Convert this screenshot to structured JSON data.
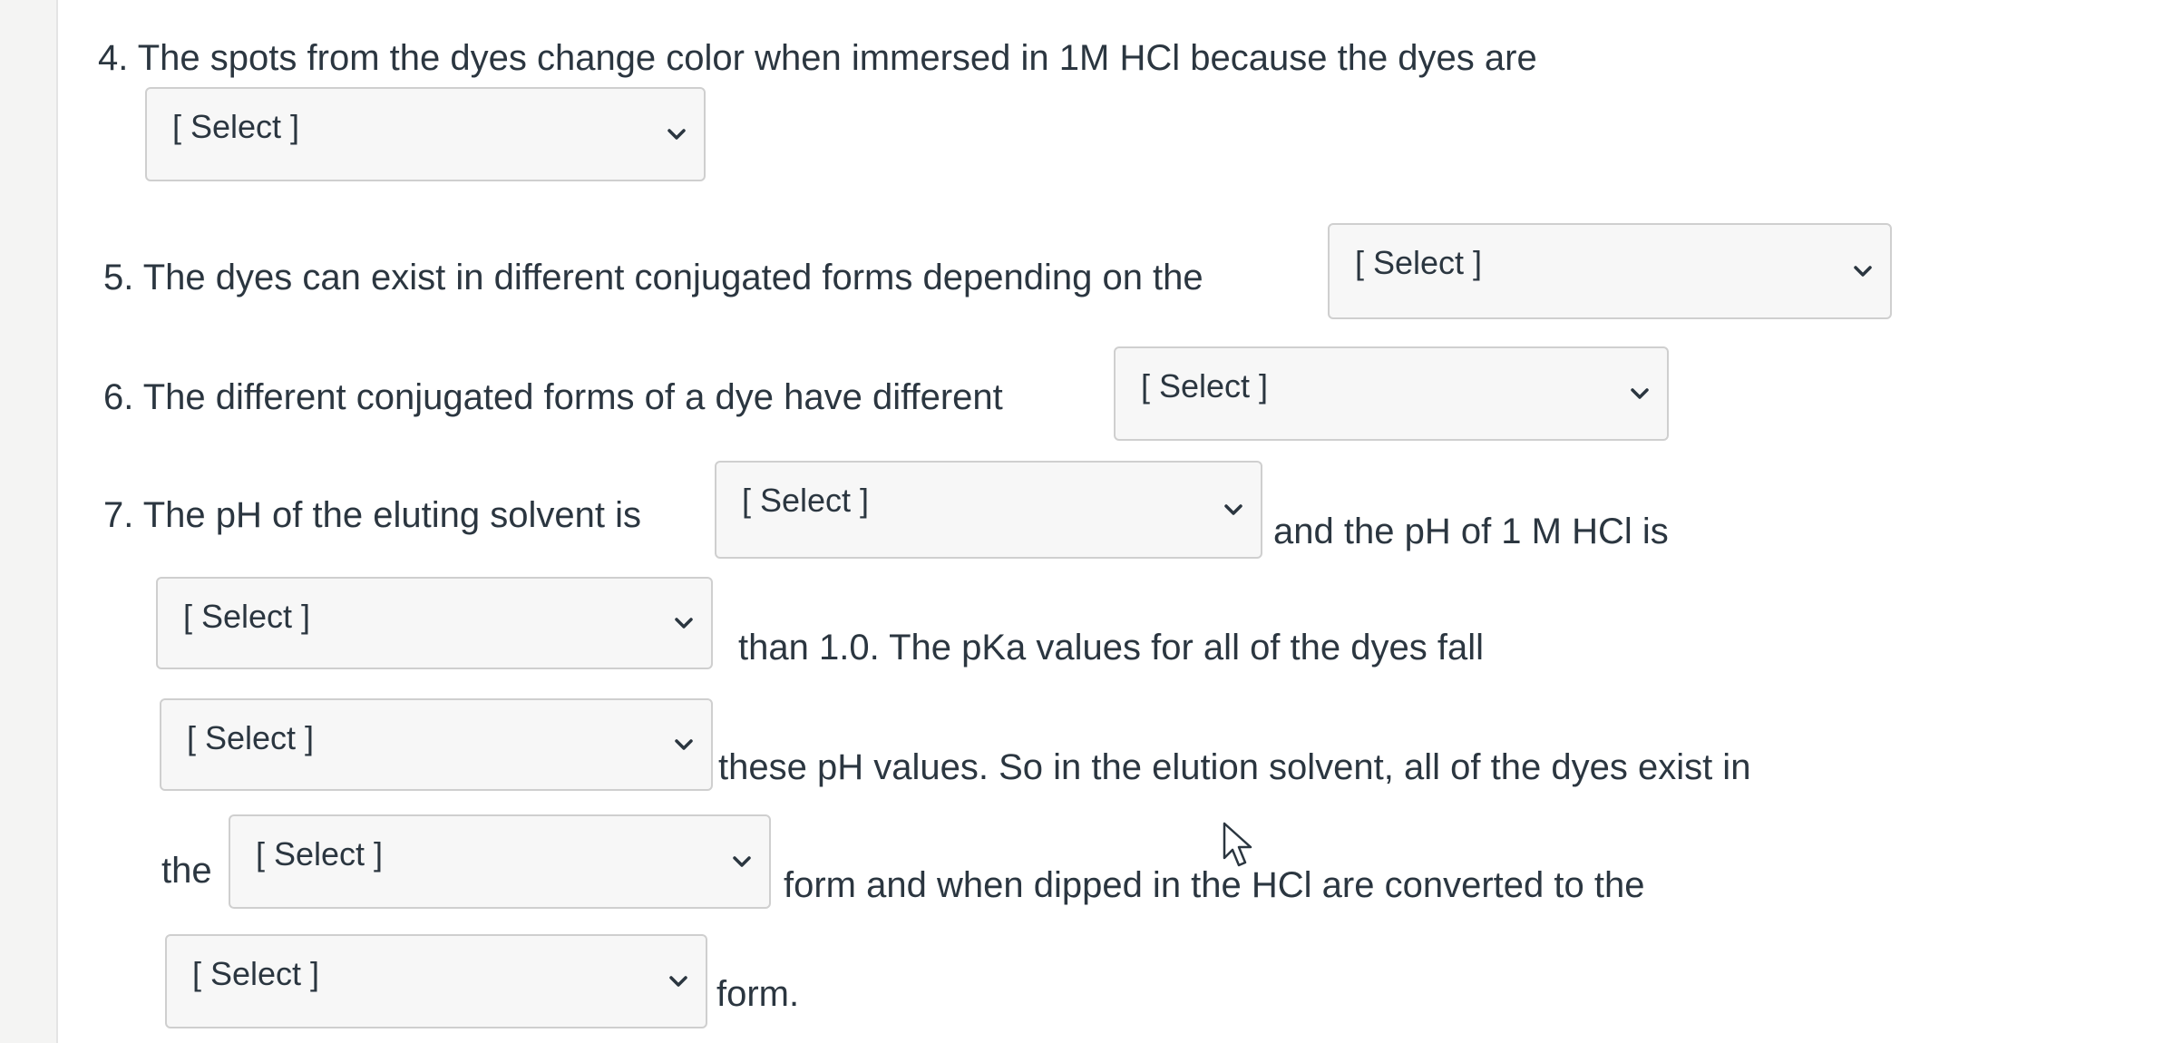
{
  "q4": {
    "text": "4. The spots from the dyes change color when immersed in 1M HCl because the dyes are"
  },
  "q5": {
    "text": "5. The dyes can exist in different conjugated forms depending on the"
  },
  "q6": {
    "text": "6. The different conjugated forms of a dye have different"
  },
  "q7": {
    "text_before": "7. The pH of the eluting solvent is",
    "text_after_1": "and the pH of 1 M HCl is",
    "text_after_2": "than 1.0. The pKa values for all of the dyes fall",
    "text_after_3": "these pH values. So in the elution solvent, all of the dyes exist in",
    "text_the": "the",
    "text_after_4": "form and when dipped in the HCl are converted to the",
    "text_after_5": "form."
  },
  "select": {
    "placeholder": "[ Select ]"
  },
  "icons": {
    "chevron": "chevron-down-icon",
    "cursor": "mouse-pointer-icon"
  }
}
